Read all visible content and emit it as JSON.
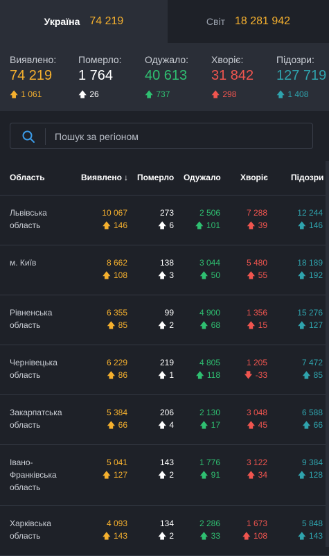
{
  "tabs": [
    {
      "name": "Україна",
      "value": "74 219"
    },
    {
      "name": "Світ",
      "value": "18 281 942"
    }
  ],
  "summary": {
    "confirmed": {
      "label": "Виявлено:",
      "value": "74 219",
      "delta": "1 061",
      "color": "#f5b02e"
    },
    "deaths": {
      "label": "Померло:",
      "value": "1 764",
      "delta": "26",
      "color": "#ffffff"
    },
    "recovered": {
      "label": "Одужало:",
      "value": "40 613",
      "delta": "737",
      "color": "#2fbf71"
    },
    "ill": {
      "label": "Хворіє:",
      "value": "31 842",
      "delta": "298",
      "color": "#f0554f"
    },
    "suspected": {
      "label": "Підозри:",
      "value": "127 719",
      "delta": "1 408",
      "color": "#2fa3ad"
    }
  },
  "search": {
    "placeholder": "Пошук за регіоном"
  },
  "table": {
    "headers": {
      "region": "Область",
      "confirmed": "Виявлено",
      "deaths": "Померло",
      "recovered": "Одужало",
      "ill": "Хворіє",
      "suspected": "Підозри"
    },
    "rows": [
      {
        "region": "Львівська область",
        "confirmed": "10 067",
        "confirmed_d": "146",
        "deaths": "273",
        "deaths_d": "6",
        "recovered": "2 506",
        "recovered_d": "101",
        "ill": "7 288",
        "ill_d": "39",
        "ill_dir": "up",
        "suspected": "12 244",
        "suspected_d": "146"
      },
      {
        "region": "м. Київ",
        "confirmed": "8 662",
        "confirmed_d": "108",
        "deaths": "138",
        "deaths_d": "3",
        "recovered": "3 044",
        "recovered_d": "50",
        "ill": "5 480",
        "ill_d": "55",
        "ill_dir": "up",
        "suspected": "18 189",
        "suspected_d": "192"
      },
      {
        "region": "Рівненська область",
        "confirmed": "6 355",
        "confirmed_d": "85",
        "deaths": "99",
        "deaths_d": "2",
        "recovered": "4 900",
        "recovered_d": "68",
        "ill": "1 356",
        "ill_d": "15",
        "ill_dir": "up",
        "suspected": "15 276",
        "suspected_d": "127"
      },
      {
        "region": "Чернівецька область",
        "confirmed": "6 229",
        "confirmed_d": "86",
        "deaths": "219",
        "deaths_d": "1",
        "recovered": "4 805",
        "recovered_d": "118",
        "ill": "1 205",
        "ill_d": "-33",
        "ill_dir": "down",
        "suspected": "7 472",
        "suspected_d": "85"
      },
      {
        "region": "Закарпатська область",
        "confirmed": "5 384",
        "confirmed_d": "66",
        "deaths": "206",
        "deaths_d": "4",
        "recovered": "2 130",
        "recovered_d": "17",
        "ill": "3 048",
        "ill_d": "45",
        "ill_dir": "up",
        "suspected": "6 588",
        "suspected_d": "66"
      },
      {
        "region": "Івано-Франківська область",
        "confirmed": "5 041",
        "confirmed_d": "127",
        "deaths": "143",
        "deaths_d": "2",
        "recovered": "1 776",
        "recovered_d": "91",
        "ill": "3 122",
        "ill_d": "34",
        "ill_dir": "up",
        "suspected": "9 384",
        "suspected_d": "128"
      },
      {
        "region": "Харківська область",
        "confirmed": "4 093",
        "confirmed_d": "143",
        "deaths": "134",
        "deaths_d": "2",
        "recovered": "2 286",
        "recovered_d": "33",
        "ill": "1 673",
        "ill_d": "108",
        "ill_dir": "up",
        "suspected": "5 848",
        "suspected_d": "143"
      }
    ]
  }
}
